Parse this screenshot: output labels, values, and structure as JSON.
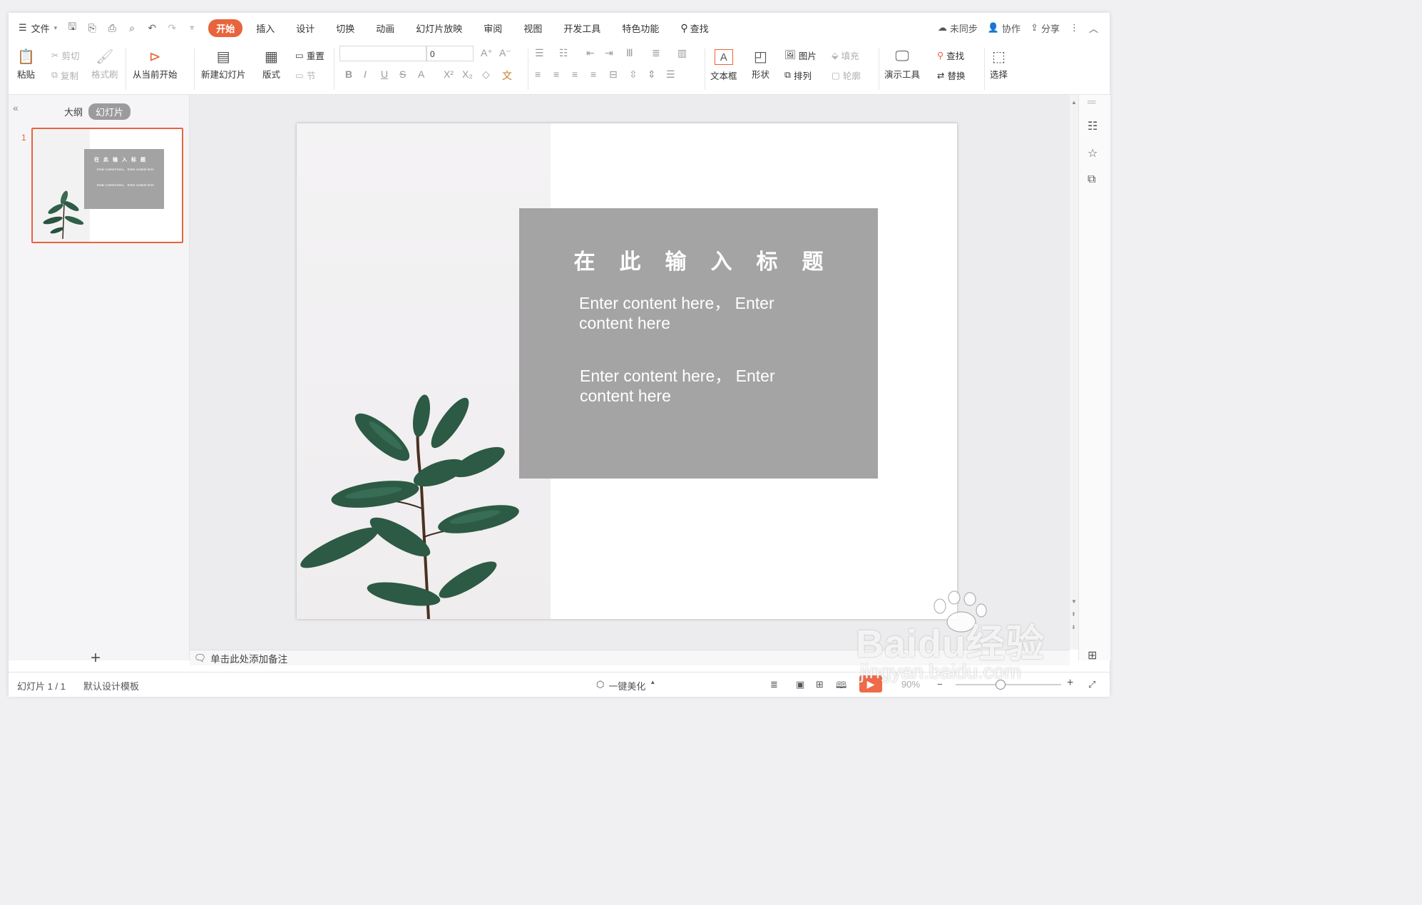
{
  "menu": {
    "file_label": "文件",
    "tabs": [
      "开始",
      "插入",
      "设计",
      "切换",
      "动画",
      "幻灯片放映",
      "审阅",
      "视图",
      "开发工具",
      "特色功能"
    ],
    "active_tab": "开始",
    "search_label": "查找",
    "right": {
      "sync": "未同步",
      "collab": "协作",
      "share": "分享"
    }
  },
  "ribbon": {
    "paste": "粘贴",
    "cut": "剪切",
    "copy": "复制",
    "format_painter": "格式刷",
    "from_current": "从当前开始",
    "new_slide": "新建幻灯片",
    "layout": "版式",
    "reset": "重置",
    "section": "节",
    "font_size": "0",
    "text_box": "文本框",
    "shape": "形状",
    "picture": "图片",
    "fill": "填充",
    "arrange": "排列",
    "outline": "轮廓",
    "present_tools": "演示工具",
    "find": "查找",
    "replace": "替换",
    "select": "选择"
  },
  "left_panel": {
    "tab_outline": "大纲",
    "tab_slides": "幻灯片",
    "slide_number": "1"
  },
  "slide": {
    "title": "在此输入标题",
    "body1": "Enter content here， Enter content here",
    "body2": "Enter content here， Enter content here",
    "thumb_title": "在此输入标题",
    "thumb_body1": "Enter content here， Enter content here",
    "thumb_body2": "Enter content here， Enter content here",
    "box_color": "#a4a4a4"
  },
  "notes_placeholder": "单击此处添加备注",
  "status": {
    "slide_count": "幻灯片 1 / 1",
    "template": "默认设计模板",
    "beautify": "一键美化",
    "zoom": "90%"
  },
  "watermark": {
    "brand": "Baidu经验",
    "url": "jingyan.baidu.com"
  },
  "colors": {
    "accent": "#e8643c"
  }
}
